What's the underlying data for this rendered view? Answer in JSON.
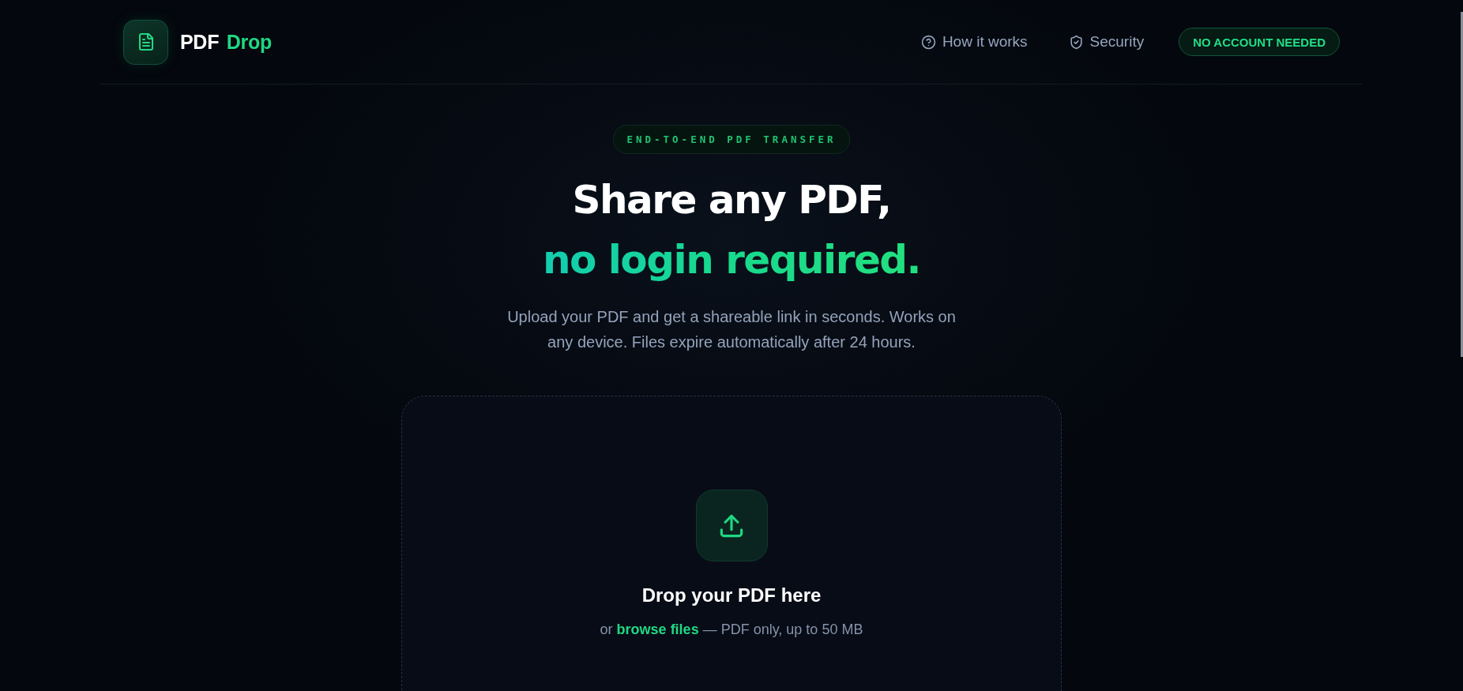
{
  "header": {
    "logo": {
      "name": "PDF",
      "accent": "Drop"
    },
    "nav": [
      {
        "label": "How it works"
      },
      {
        "label": "Security"
      }
    ],
    "badge": "NO ACCOUNT NEEDED"
  },
  "hero": {
    "tag": "END-TO-END PDF TRANSFER",
    "title_line_1": "Share any PDF,",
    "title_line_2": "no login required.",
    "description": "Upload your PDF and get a shareable link in seconds. Works on any device. Files expire automatically after 24 hours."
  },
  "dropzone": {
    "title": "Drop your PDF here",
    "hint_before": "or",
    "link": "browse files",
    "hint_after": "— PDF only, up to 50 MB"
  }
}
